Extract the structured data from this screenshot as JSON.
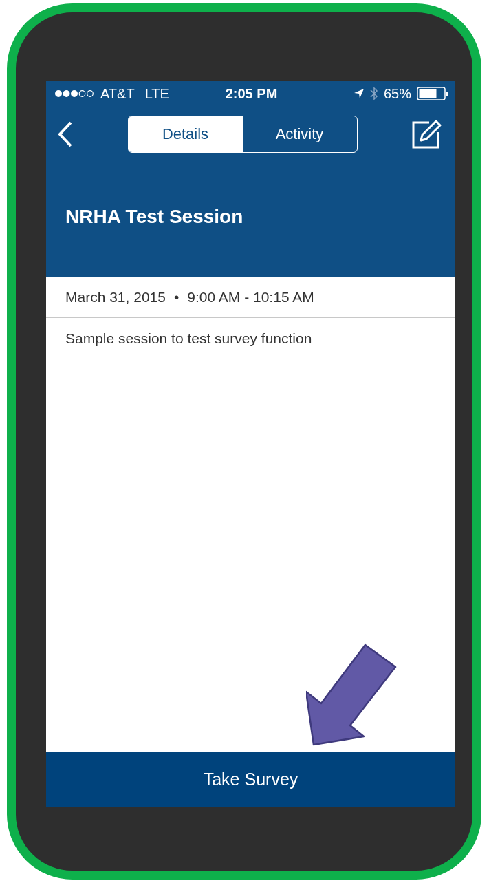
{
  "status_bar": {
    "carrier": "AT&T",
    "network": "LTE",
    "time": "2:05 PM",
    "battery": "65%"
  },
  "nav": {
    "tabs": [
      {
        "label": "Details",
        "selected": true
      },
      {
        "label": "Activity",
        "selected": false
      }
    ]
  },
  "session": {
    "title": "NRHA Test Session",
    "date": "March 31, 2015",
    "separator": "•",
    "time": "9:00 AM - 10:15 AM",
    "description": "Sample session to test survey function"
  },
  "action_button": "Take Survey"
}
